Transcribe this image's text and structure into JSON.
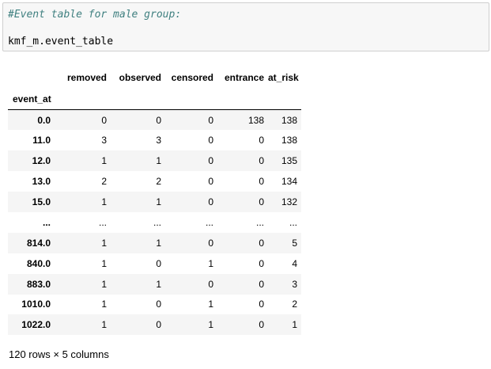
{
  "code_cell": {
    "comment": "#Event table for male group:",
    "statement": "kmf_m.event_table"
  },
  "dataframe": {
    "columns": [
      "removed",
      "observed",
      "censored",
      "entrance",
      "at_risk"
    ],
    "index_name": "event_at",
    "rows": [
      {
        "index": "0.0",
        "values": [
          "0",
          "0",
          "0",
          "138",
          "138"
        ]
      },
      {
        "index": "11.0",
        "values": [
          "3",
          "3",
          "0",
          "0",
          "138"
        ]
      },
      {
        "index": "12.0",
        "values": [
          "1",
          "1",
          "0",
          "0",
          "135"
        ]
      },
      {
        "index": "13.0",
        "values": [
          "2",
          "2",
          "0",
          "0",
          "134"
        ]
      },
      {
        "index": "15.0",
        "values": [
          "1",
          "1",
          "0",
          "0",
          "132"
        ]
      },
      {
        "index": "...",
        "values": [
          "...",
          "...",
          "...",
          "...",
          "..."
        ]
      },
      {
        "index": "814.0",
        "values": [
          "1",
          "1",
          "0",
          "0",
          "5"
        ]
      },
      {
        "index": "840.0",
        "values": [
          "1",
          "0",
          "1",
          "0",
          "4"
        ]
      },
      {
        "index": "883.0",
        "values": [
          "1",
          "1",
          "0",
          "0",
          "3"
        ]
      },
      {
        "index": "1010.0",
        "values": [
          "1",
          "0",
          "1",
          "0",
          "2"
        ]
      },
      {
        "index": "1022.0",
        "values": [
          "1",
          "0",
          "1",
          "0",
          "1"
        ]
      }
    ],
    "shape_note": "120 rows × 5 columns"
  }
}
